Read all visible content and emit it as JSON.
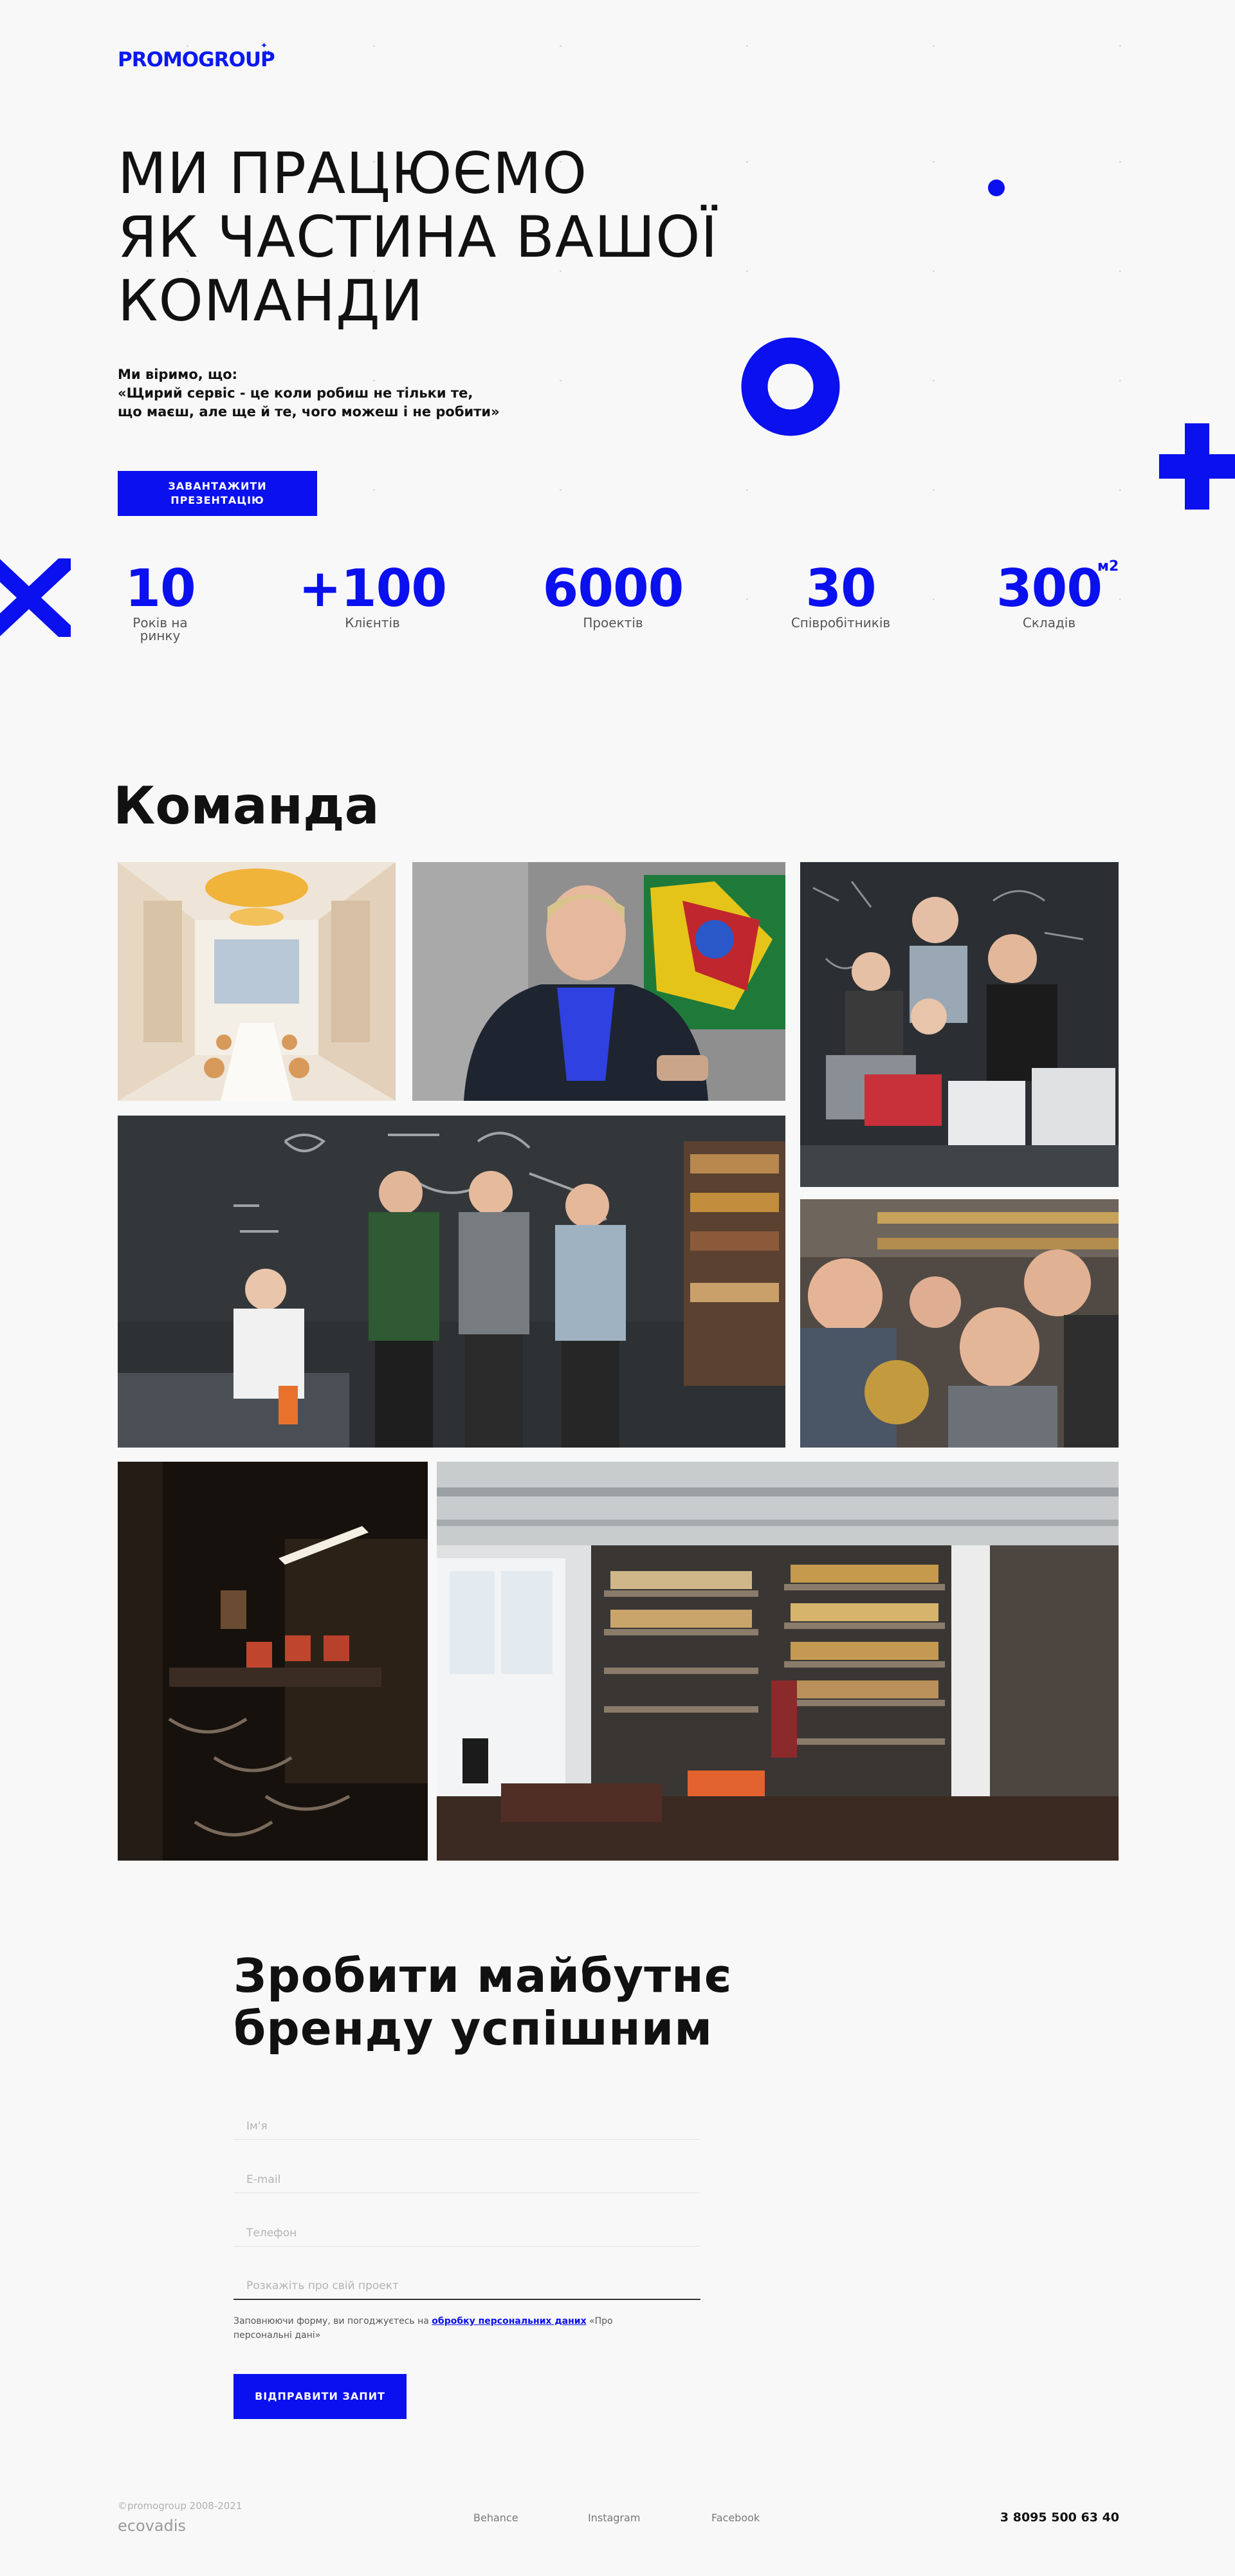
{
  "brand": {
    "logo": "PROMOGROUP",
    "accent_color": "#0a10ee"
  },
  "hero": {
    "title_lines": [
      "МИ ПРАЦЮЄМО",
      "ЯК ЧАСТИНА ВАШОЇ",
      "КОМАНДИ"
    ],
    "belief_lines": [
      "Ми віримо, що:",
      "«Щирий сервіс - це коли робиш не тільки те,",
      "що маєш, але ще й те, чого можеш і не робити»"
    ],
    "download_button_lines": [
      "ЗАВАНТАЖИТИ",
      "ПРЕЗЕНТАЦІЮ"
    ]
  },
  "stats": [
    {
      "value": "10",
      "label_lines": [
        "Років на",
        "ринку"
      ]
    },
    {
      "value": "+100",
      "label_lines": [
        "Клієнтів"
      ]
    },
    {
      "value": "6000",
      "label_lines": [
        "Проектів"
      ]
    },
    {
      "value": "30",
      "label_lines": [
        "Співробітників"
      ]
    },
    {
      "value": "300",
      "unit": "м2",
      "label_lines": [
        "Складів"
      ]
    }
  ],
  "team": {
    "title": "Команда",
    "photos": [
      "meeting-room",
      "man-portrait",
      "team-at-laptop",
      "team-chalkboard",
      "team-selfie",
      "dark-office",
      "showroom-shelves"
    ]
  },
  "cta": {
    "title_lines": [
      "Зробити майбутнє",
      "бренду успішним"
    ],
    "fields": [
      {
        "name": "name",
        "placeholder": "Ім'я"
      },
      {
        "name": "email",
        "placeholder": "E-mail"
      },
      {
        "name": "phone",
        "placeholder": "Телефон"
      },
      {
        "name": "project",
        "placeholder": "Розкажіть про свій проект"
      }
    ],
    "consent_prefix": "Заповнюючи форму, ви погоджуєтесь на ",
    "consent_link": "обробку персональних даних",
    "consent_suffix": " «Про персональні дані»",
    "submit_label": "ВІДПРАВИТИ ЗАПИТ"
  },
  "footer": {
    "copyright": "©promogroup 2008-2021",
    "partner": "ecovadis",
    "links": [
      "Behance",
      "Instagram",
      "Facebook"
    ],
    "phone": "3 8095 500 63 40"
  }
}
